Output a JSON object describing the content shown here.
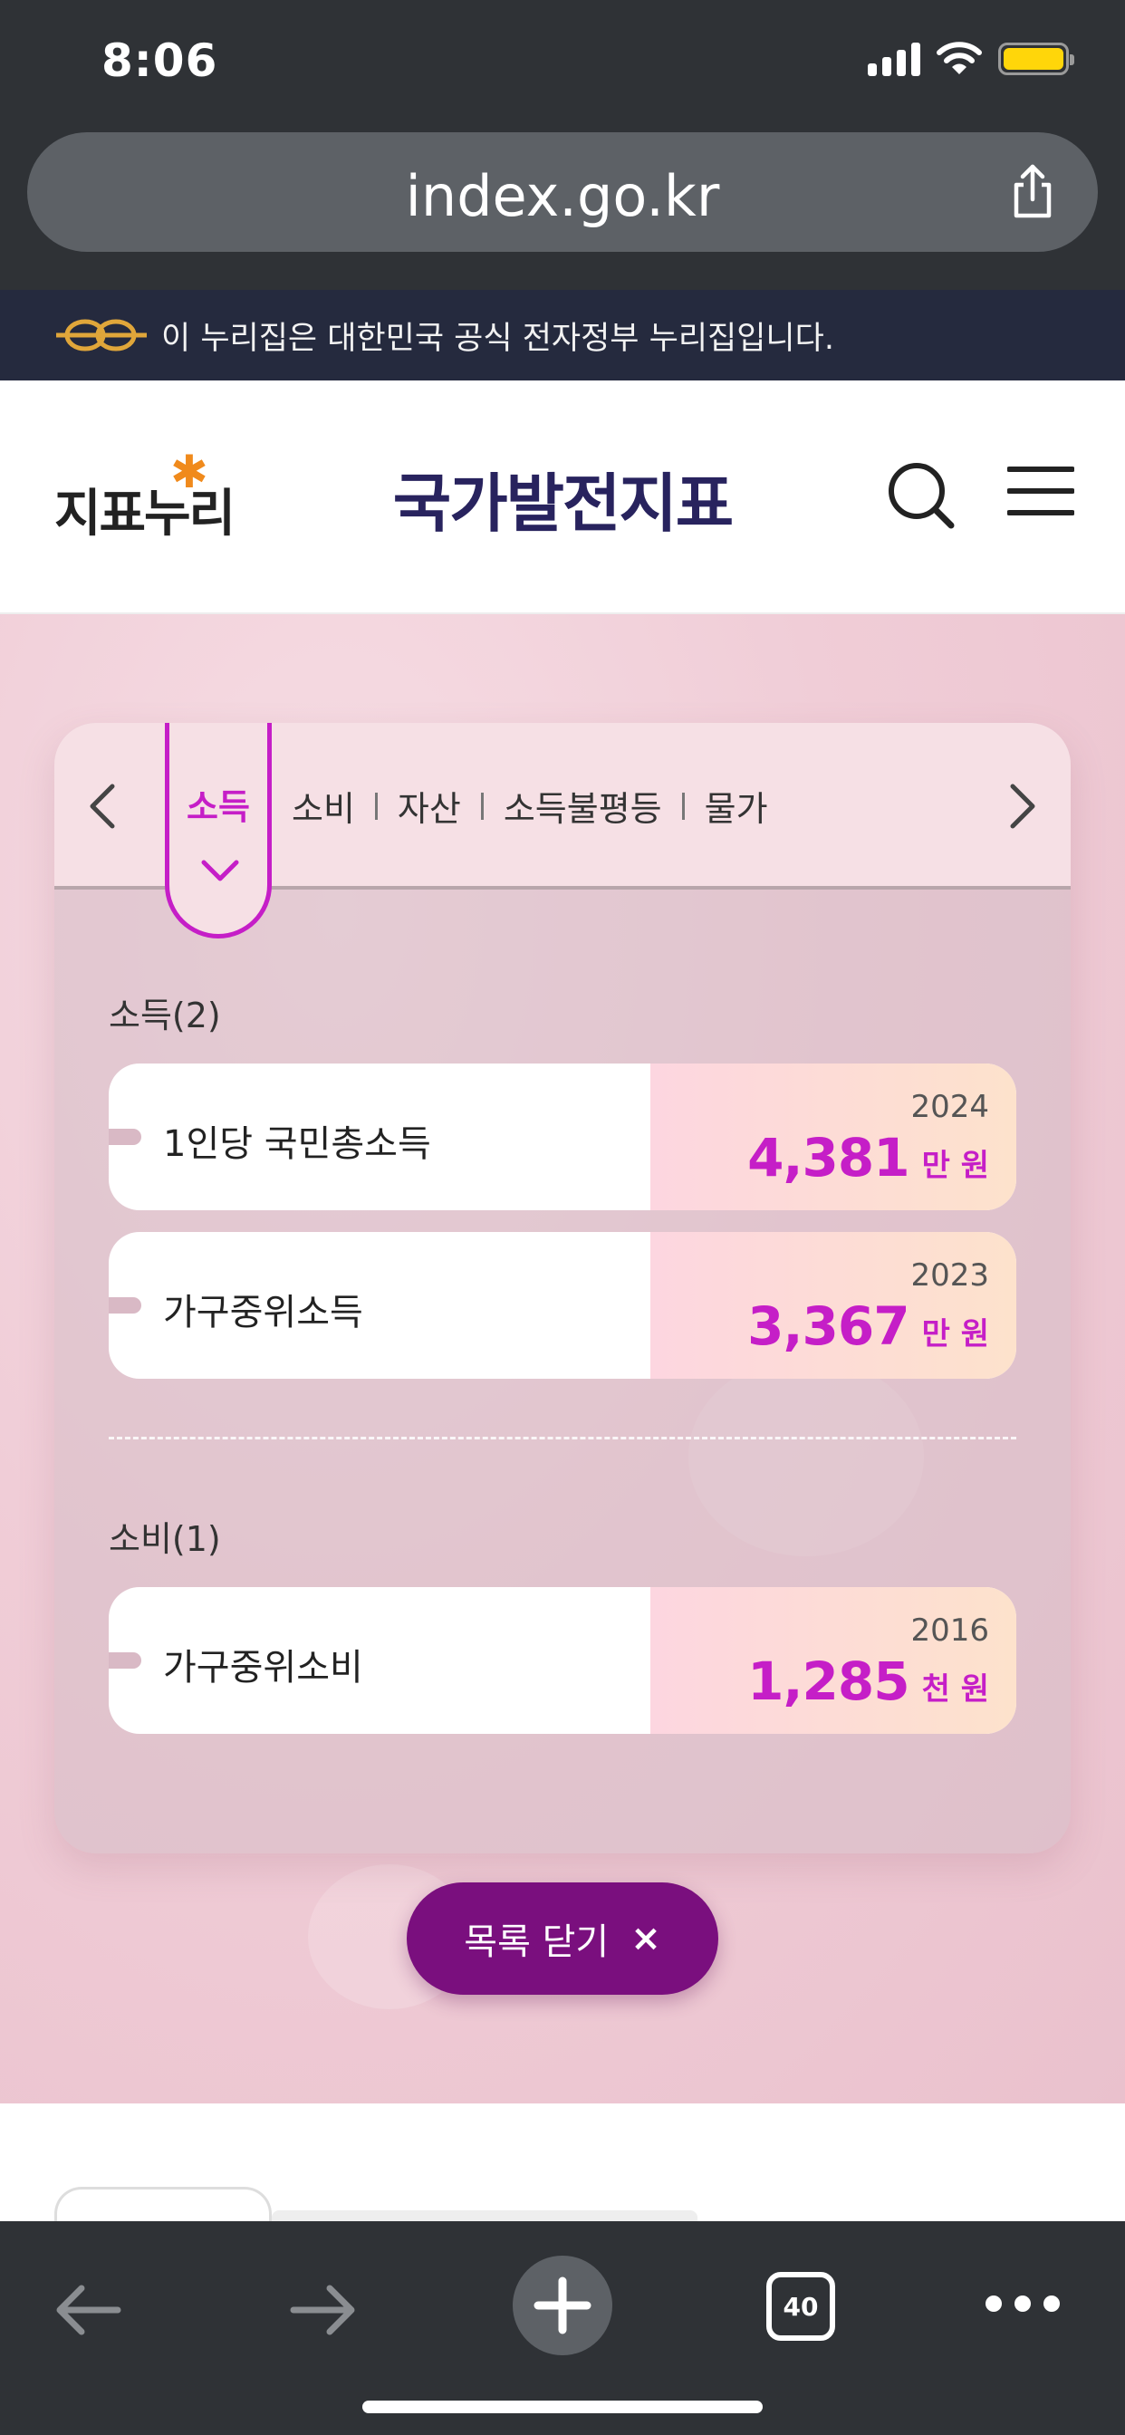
{
  "status_bar": {
    "time": "8:06"
  },
  "browser": {
    "url": "index.go.kr",
    "tab_count": "40"
  },
  "gov_banner": {
    "text": "이 누리집은 대한민국 공식 전자정부 누리집입니다."
  },
  "header": {
    "logo": "지표누리",
    "title": "국가발전지표"
  },
  "tabs": {
    "active": "소득",
    "items": [
      "소비",
      "자산",
      "소득불평등",
      "물가"
    ]
  },
  "sections": [
    {
      "title": "소득(2)",
      "rows": [
        {
          "label": "1인당 국민총소득",
          "year": "2024",
          "value": "4,381",
          "unit": "만 원"
        },
        {
          "label": "가구중위소득",
          "year": "2023",
          "value": "3,367",
          "unit": "만 원"
        }
      ]
    },
    {
      "title": "소비(1)",
      "rows": [
        {
          "label": "가구중위소비",
          "year": "2016",
          "value": "1,285",
          "unit": "천 원"
        }
      ]
    }
  ],
  "close_button": {
    "label": "목록 닫기",
    "icon": "×"
  },
  "colors": {
    "accent": "#c51ec7",
    "button": "#7a0f7e",
    "title": "#28235e"
  }
}
